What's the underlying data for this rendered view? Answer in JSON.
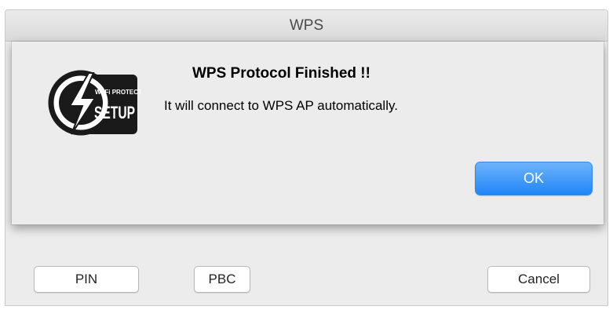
{
  "window": {
    "title": "WPS"
  },
  "dialog": {
    "logo": {
      "icon": "wifi-protected-setup-logo",
      "text_top": "Wi-Fi PROTECTED",
      "text_main": "SETUP"
    },
    "heading": "WPS Protocol Finished !!",
    "message": "It will connect to WPS AP automatically.",
    "ok_label": "OK"
  },
  "buttons": {
    "pin_label": "PIN",
    "pbc_label": "PBC",
    "cancel_label": "Cancel"
  },
  "colors": {
    "accent": "#1f86f7",
    "window_bg": "#ececec"
  }
}
